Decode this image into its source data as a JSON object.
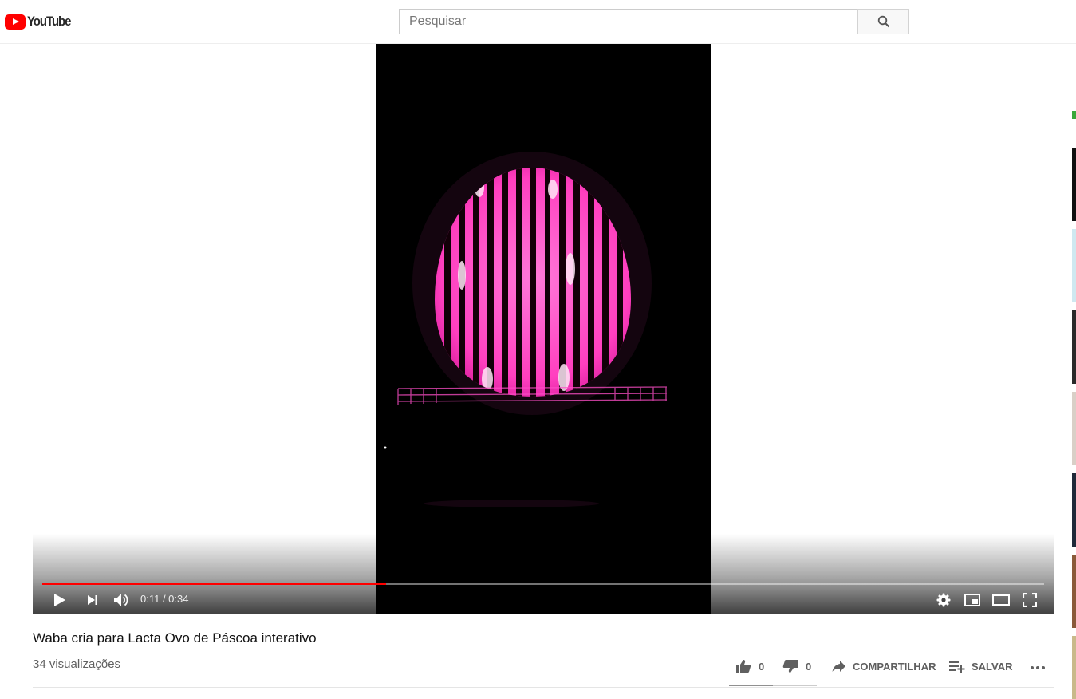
{
  "header": {
    "logo_text": "YouTube",
    "search_placeholder": "Pesquisar",
    "search_icon": "search-icon"
  },
  "player": {
    "current_time": "0:11",
    "duration": "0:34",
    "time_display": "0:11 / 0:34",
    "progress_fraction": 0.343,
    "progress_color": "#ff0000",
    "controls": [
      "play-icon",
      "next-icon",
      "volume-icon",
      "settings-icon",
      "miniplayer-icon",
      "theater-icon",
      "fullscreen-icon"
    ]
  },
  "video": {
    "title": "Waba cria para Lacta Ovo de Páscoa interativo",
    "views": "34 visualizações"
  },
  "actions": {
    "likes": "0",
    "dislikes": "0",
    "share_label": "COMPARTILHAR",
    "save_label": "SALVAR",
    "like_fraction": 0.5
  },
  "colors": {
    "brand": "#ff0000",
    "egg_pink": "#ff4fc8",
    "text_primary": "#111111",
    "text_secondary": "#606060"
  }
}
